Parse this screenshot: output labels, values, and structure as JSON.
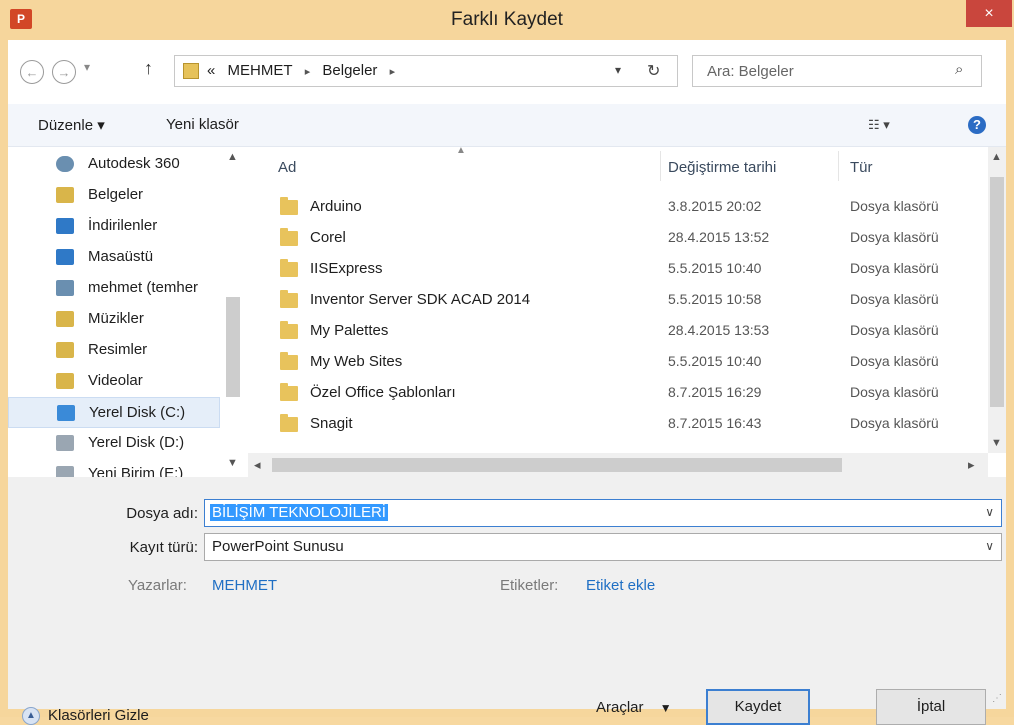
{
  "window": {
    "title": "Farklı Kaydet",
    "app_icon": "P",
    "close": "×"
  },
  "nav": {
    "back": "←",
    "forward": "→",
    "up": "↑",
    "breadcrumbs": [
      "«",
      "MEHMET",
      "Belgeler"
    ],
    "search_placeholder": "Ara: Belgeler"
  },
  "toolbar": {
    "organize": "Düzenle ▾",
    "new_folder": "Yeni klasör",
    "view": "☷ ▾",
    "help": "?"
  },
  "sidebar": {
    "items": [
      {
        "label": "Autodesk 360",
        "icon": "cloud-icon",
        "color": "#6a8fb0"
      },
      {
        "label": "Belgeler",
        "icon": "documents-icon",
        "color": "#d9b54a"
      },
      {
        "label": "İndirilenler",
        "icon": "downloads-icon",
        "color": "#2f79c7"
      },
      {
        "label": "Masaüstü",
        "icon": "desktop-icon",
        "color": "#2f79c7"
      },
      {
        "label": "mehmet (temher",
        "icon": "network-user-icon",
        "color": "#6a8fb0"
      },
      {
        "label": "Müzikler",
        "icon": "music-icon",
        "color": "#d9b54a"
      },
      {
        "label": "Resimler",
        "icon": "pictures-icon",
        "color": "#d9b54a"
      },
      {
        "label": "Videolar",
        "icon": "videos-icon",
        "color": "#d9b54a"
      },
      {
        "label": "Yerel Disk (C:)",
        "icon": "drive-c-icon",
        "color": "#3a8ad8"
      },
      {
        "label": "Yerel Disk (D:)",
        "icon": "drive-icon",
        "color": "#9aa6b2"
      },
      {
        "label": "Yeni Birim (E:)",
        "icon": "drive-icon",
        "color": "#9aa6b2"
      }
    ]
  },
  "columns": {
    "name": "Ad",
    "date": "Değiştirme tarihi",
    "type": "Tür"
  },
  "files": [
    {
      "name": "Arduino",
      "date": "3.8.2015 20:02",
      "type": "Dosya klasörü"
    },
    {
      "name": "Corel",
      "date": "28.4.2015 13:52",
      "type": "Dosya klasörü"
    },
    {
      "name": "IISExpress",
      "date": "5.5.2015 10:40",
      "type": "Dosya klasörü"
    },
    {
      "name": "Inventor Server SDK ACAD 2014",
      "date": "5.5.2015 10:58",
      "type": "Dosya klasörü"
    },
    {
      "name": "My Palettes",
      "date": "28.4.2015 13:53",
      "type": "Dosya klasörü"
    },
    {
      "name": "My Web Sites",
      "date": "5.5.2015 10:40",
      "type": "Dosya klasörü"
    },
    {
      "name": "Özel Office Şablonları",
      "date": "8.7.2015 16:29",
      "type": "Dosya klasörü"
    },
    {
      "name": "Snagit",
      "date": "8.7.2015 16:43",
      "type": "Dosya klasörü"
    }
  ],
  "form": {
    "filename_label": "Dosya adı:",
    "filename_value": "BİLİŞİM TEKNOLOJİLERİ",
    "filetype_label": "Kayıt türü:",
    "filetype_value": "PowerPoint Sunusu",
    "authors_label": "Yazarlar:",
    "authors_value": "MEHMET",
    "tags_label": "Etiketler:",
    "tags_value": "Etiket ekle"
  },
  "footer": {
    "hide_folders": "Klasörleri Gizle",
    "tools": "Araçlar",
    "save": "Kaydet",
    "cancel": "İptal"
  }
}
